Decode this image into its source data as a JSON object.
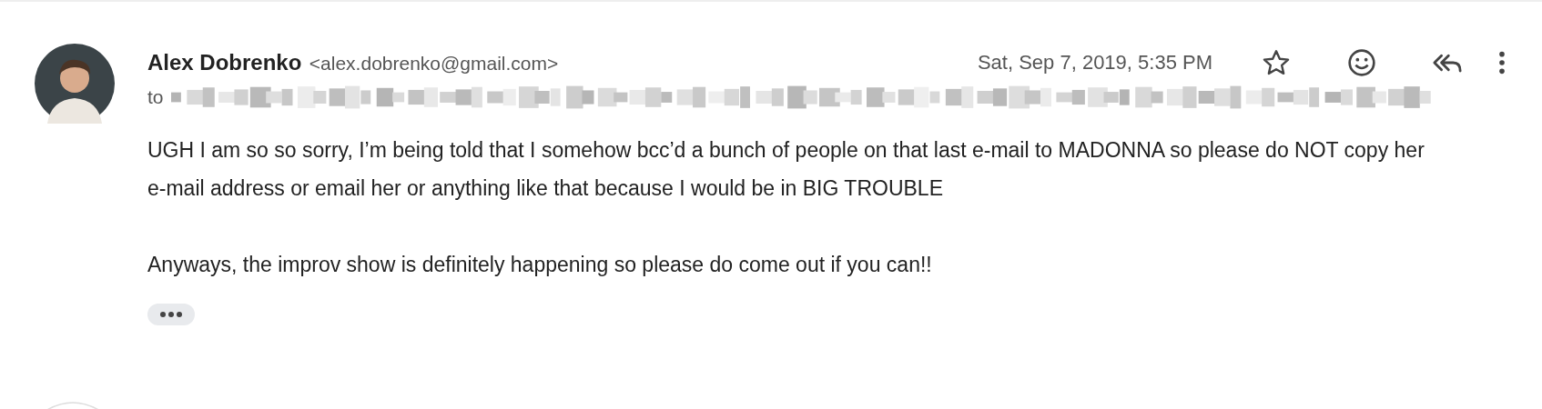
{
  "message": {
    "sender_name": "Alex Dobrenko",
    "sender_email": "<alex.dobrenko@gmail.com>",
    "date": "Sat, Sep 7, 2019, 5:35 PM",
    "starred": false,
    "to_label": "to",
    "body": [
      "UGH I am so so sorry, I’m being told that I somehow bcc’d a bunch of people on that last e-mail to MADONNA so please do NOT copy her e-mail address or email her or anything like that because I would be in BIG TROUBLE",
      "Anyways, the improv show is definitely happening so please do come out if you can!!"
    ]
  }
}
